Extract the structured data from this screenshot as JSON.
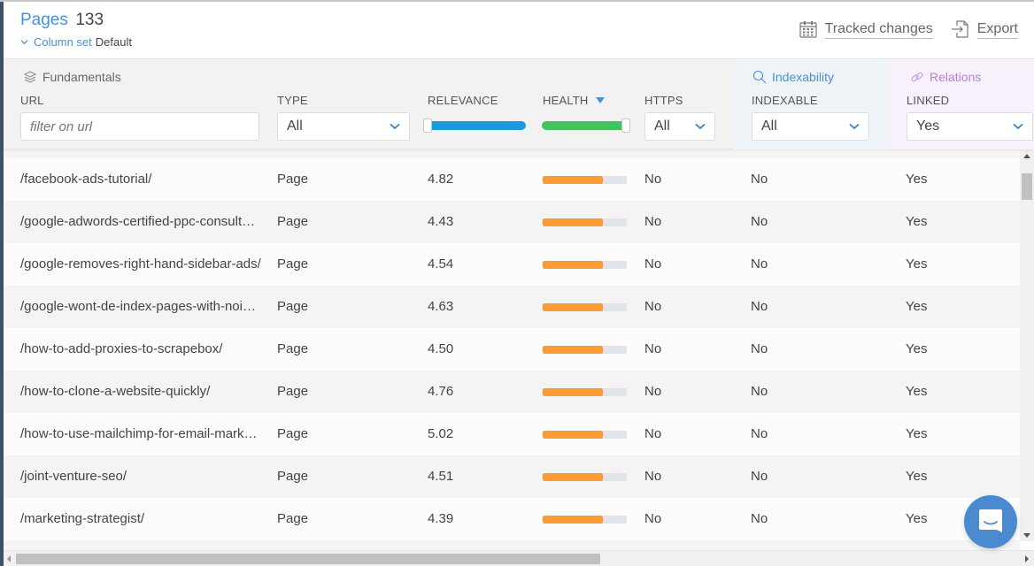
{
  "header": {
    "title": "Pages",
    "count": "133",
    "column_set_label": "Column set",
    "column_set_value": "Default",
    "actions": {
      "tracked_changes": "Tracked changes",
      "export": "Export"
    }
  },
  "groups": {
    "fundamentals": "Fundamentals",
    "indexability": "Indexability",
    "relations": "Relations"
  },
  "columns": {
    "url": "URL",
    "type": "TYPE",
    "relevance": "RELEVANCE",
    "health": "HEALTH",
    "https": "HTTPS",
    "indexable": "INDEXABLE",
    "linked": "LINKED"
  },
  "filters": {
    "url_placeholder": "filter on url",
    "url_value": "",
    "type": "All",
    "https": "All",
    "indexable": "All",
    "linked": "Yes",
    "relevance_range": "full",
    "health_range": "full",
    "health_sort": "descending"
  },
  "colors": {
    "accent": "#4a90d9",
    "relations": "#b77fdc",
    "relevance_slider": "#1a9be0",
    "health_slider": "#41c45f",
    "health_bar": "#fd9a33",
    "chat_button": "#4a8bd0"
  },
  "rows": [
    {
      "url": "/facebook-ads-tutorial/",
      "type": "Page",
      "relevance": "4.82",
      "health": 0.72,
      "https": "No",
      "indexable": "No",
      "linked": "Yes"
    },
    {
      "url": "/google-adwords-certified-ppc-consultant/",
      "type": "Page",
      "relevance": "4.43",
      "health": 0.72,
      "https": "No",
      "indexable": "No",
      "linked": "Yes"
    },
    {
      "url": "/google-removes-right-hand-sidebar-ads/",
      "type": "Page",
      "relevance": "4.54",
      "health": 0.72,
      "https": "No",
      "indexable": "No",
      "linked": "Yes"
    },
    {
      "url": "/google-wont-de-index-pages-with-noindex/",
      "type": "Page",
      "relevance": "4.63",
      "health": 0.72,
      "https": "No",
      "indexable": "No",
      "linked": "Yes"
    },
    {
      "url": "/how-to-add-proxies-to-scrapebox/",
      "type": "Page",
      "relevance": "4.50",
      "health": 0.72,
      "https": "No",
      "indexable": "No",
      "linked": "Yes"
    },
    {
      "url": "/how-to-clone-a-website-quickly/",
      "type": "Page",
      "relevance": "4.76",
      "health": 0.72,
      "https": "No",
      "indexable": "No",
      "linked": "Yes"
    },
    {
      "url": "/how-to-use-mailchimp-for-email-marketing/",
      "type": "Page",
      "relevance": "5.02",
      "health": 0.72,
      "https": "No",
      "indexable": "No",
      "linked": "Yes"
    },
    {
      "url": "/joint-venture-seo/",
      "type": "Page",
      "relevance": "4.51",
      "health": 0.72,
      "https": "No",
      "indexable": "No",
      "linked": "Yes"
    },
    {
      "url": "/marketing-strategist/",
      "type": "Page",
      "relevance": "4.39",
      "health": 0.72,
      "https": "No",
      "indexable": "No",
      "linked": "Yes"
    }
  ],
  "icons": {
    "calendar": "calendar-icon",
    "export": "export-icon",
    "layers": "layers-icon",
    "search": "search-icon",
    "link": "link-icon",
    "chat": "chat-icon"
  }
}
